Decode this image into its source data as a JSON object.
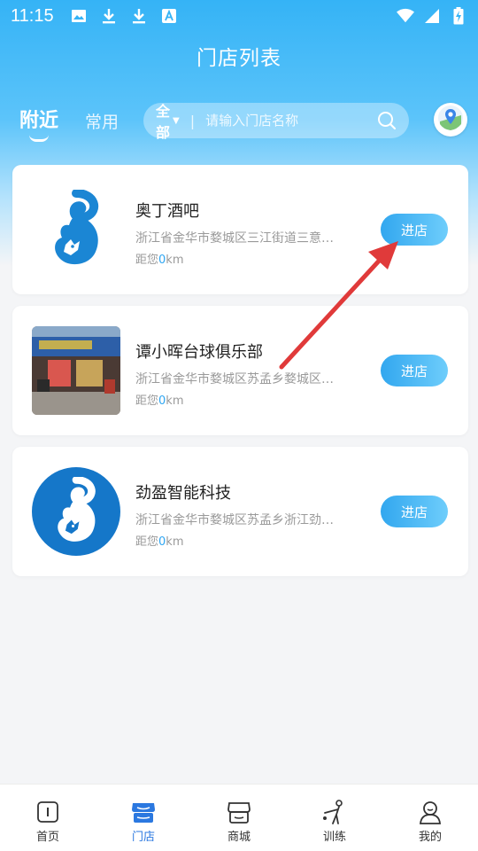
{
  "status_bar": {
    "time": "11:15",
    "left_icons": [
      "image-icon",
      "download-icon",
      "download-icon",
      "font-icon"
    ],
    "right_icons": [
      "wifi-icon",
      "signal-icon",
      "battery-charging-icon"
    ]
  },
  "header": {
    "title": "门店列表",
    "tabs": [
      {
        "label": "附近",
        "active": true
      },
      {
        "label": "常用",
        "active": false
      }
    ]
  },
  "search": {
    "scope": "全部",
    "divider": "|",
    "placeholder": "请输入门店名称"
  },
  "stores": [
    {
      "name": "奥丁酒吧",
      "address": "浙江省金华市婺城区三江街道三意…",
      "distance_prefix": "距您",
      "distance_value": "0",
      "distance_unit": "km",
      "button": "进店",
      "logo": "squirrel-logo"
    },
    {
      "name": "谭小晖台球俱乐部",
      "address": "浙江省金华市婺城区苏孟乡婺城区…",
      "distance_prefix": "距您",
      "distance_value": "0",
      "distance_unit": "km",
      "button": "进店",
      "logo": "storefront-photo"
    },
    {
      "name": "劲盈智能科技",
      "address": "浙江省金华市婺城区苏孟乡浙江劲…",
      "distance_prefix": "距您",
      "distance_value": "0",
      "distance_unit": "km",
      "button": "进店",
      "logo": "squirrel-logo"
    }
  ],
  "bottom_nav": [
    {
      "label": "首页",
      "icon": "home-icon",
      "active": false
    },
    {
      "label": "门店",
      "icon": "store-icon",
      "active": true
    },
    {
      "label": "商城",
      "icon": "shop-icon",
      "active": false
    },
    {
      "label": "训练",
      "icon": "training-icon",
      "active": false
    },
    {
      "label": "我的",
      "icon": "profile-icon",
      "active": false
    }
  ],
  "colors": {
    "header_top": "#35b3f6",
    "accent": "#2fa6f2",
    "annotation_arrow": "#e03a3a",
    "nav_active": "#2b78e0"
  }
}
